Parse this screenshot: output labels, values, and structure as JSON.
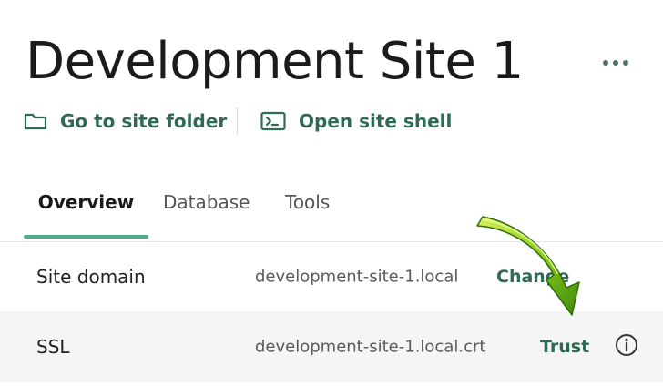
{
  "site": {
    "title": "Development Site 1"
  },
  "actions": {
    "folder_label": "Go to site folder",
    "shell_label": "Open site shell"
  },
  "tabs": [
    {
      "label": "Overview",
      "active": true
    },
    {
      "label": "Database",
      "active": false
    },
    {
      "label": "Tools",
      "active": false
    }
  ],
  "details": {
    "domain": {
      "label": "Site domain",
      "value": "development-site-1.local",
      "action": "Change"
    },
    "ssl": {
      "label": "SSL",
      "value": "development-site-1.local.crt",
      "action": "Trust"
    }
  },
  "icons": {
    "more": "more-horizontal-icon",
    "folder": "folder-icon",
    "shell": "terminal-icon",
    "info": "info-icon",
    "pointer": "arrow-pointer-icon"
  },
  "colors": {
    "accent_green": "#2e6b53",
    "tab_underline": "#50ad8a",
    "arrow_green": "#8ccc1c"
  }
}
